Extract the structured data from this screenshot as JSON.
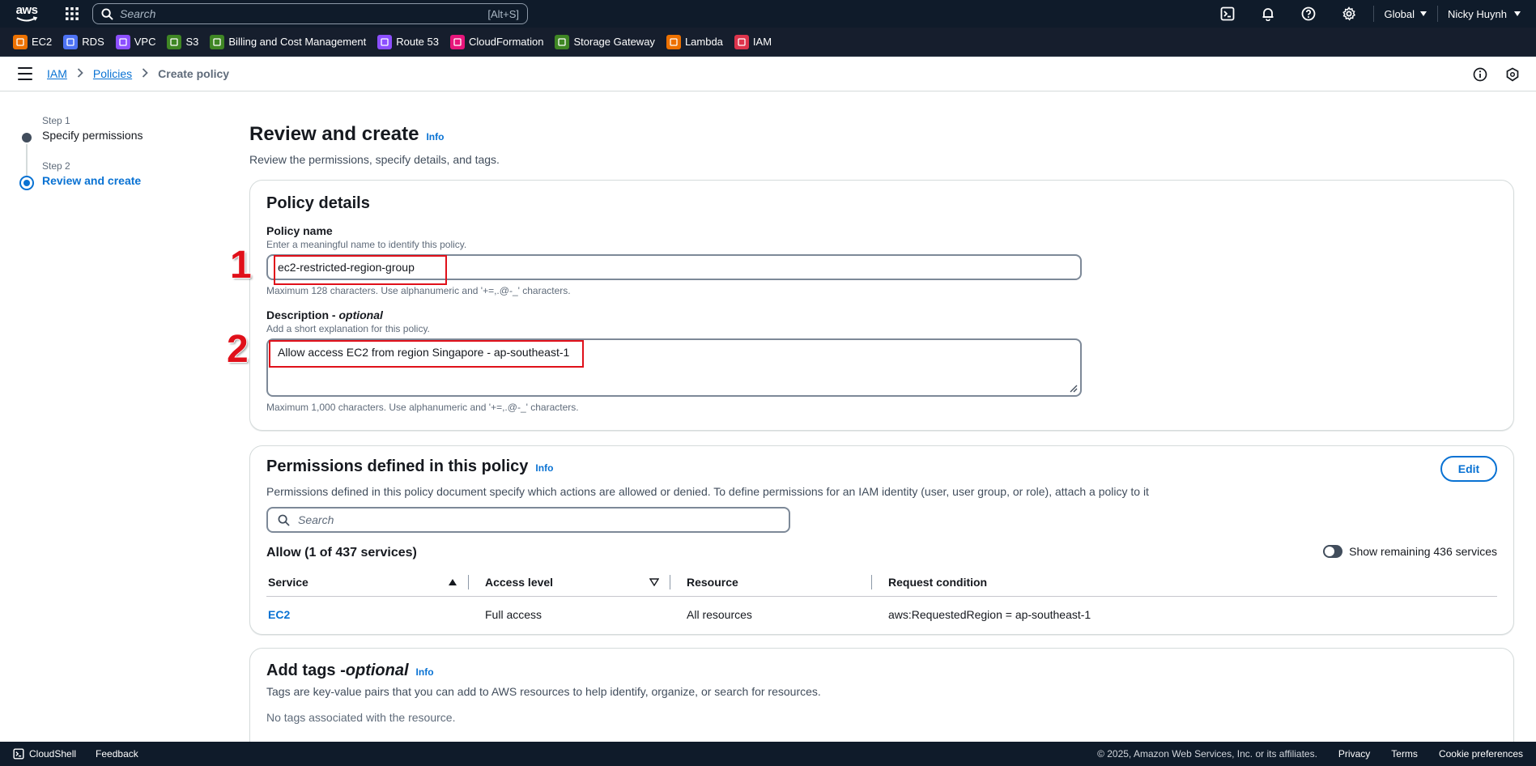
{
  "topnav": {
    "logo_text": "aws",
    "search_placeholder": "Search",
    "search_shortcut": "[Alt+S]",
    "region": "Global",
    "user": "Nicky Huynh"
  },
  "favorites": [
    {
      "label": "EC2",
      "color": "#ed7100"
    },
    {
      "label": "RDS",
      "color": "#4d72f3"
    },
    {
      "label": "VPC",
      "color": "#8c4fff"
    },
    {
      "label": "S3",
      "color": "#3f8624"
    },
    {
      "label": "Billing and Cost Management",
      "color": "#3f8624"
    },
    {
      "label": "Route 53",
      "color": "#8c4fff"
    },
    {
      "label": "CloudFormation",
      "color": "#e7157b"
    },
    {
      "label": "Storage Gateway",
      "color": "#3f8624"
    },
    {
      "label": "Lambda",
      "color": "#ed7100"
    },
    {
      "label": "IAM",
      "color": "#dd344c"
    }
  ],
  "breadcrumb": {
    "items": [
      "IAM",
      "Policies"
    ],
    "current": "Create policy"
  },
  "steps": [
    {
      "label": "Step 1",
      "title": "Specify permissions"
    },
    {
      "label": "Step 2",
      "title": "Review and create"
    }
  ],
  "page": {
    "title": "Review and create",
    "info": "Info",
    "subtitle": "Review the permissions, specify details, and tags."
  },
  "policy_details": {
    "heading": "Policy details",
    "name_label": "Policy name",
    "name_desc": "Enter a meaningful name to identify this policy.",
    "name_value": "ec2-restricted-region-group",
    "name_constraint": "Maximum 128 characters. Use alphanumeric and '+=,.@-_' characters.",
    "desc_label": "Description - ",
    "desc_optional": "optional",
    "desc_desc": "Add a short explanation for this policy.",
    "desc_value": "Allow access EC2 from region Singapore - ap-southeast-1",
    "desc_constraint": "Maximum 1,000 characters. Use alphanumeric and '+=,.@-_' characters."
  },
  "annotations": {
    "one": "1",
    "two": "2"
  },
  "permissions": {
    "heading": "Permissions defined in this policy",
    "info": "Info",
    "edit": "Edit",
    "description": "Permissions defined in this policy document specify which actions are allowed or denied. To define permissions for an IAM identity (user, user group, or role), attach a policy to it",
    "search_placeholder": "Search",
    "allow_heading": "Allow (1 of 437 services)",
    "toggle_label": "Show remaining 436 services",
    "columns": [
      "Service",
      "Access level",
      "Resource",
      "Request condition"
    ],
    "rows": [
      {
        "service": "EC2",
        "access": "Full access",
        "resource": "All resources",
        "condition": "aws:RequestedRegion = ap-southeast-1"
      }
    ]
  },
  "tags": {
    "heading": "Add tags - ",
    "optional": "optional",
    "info": "Info",
    "description": "Tags are key-value pairs that you can add to AWS resources to help identify, organize, or search for resources.",
    "empty": "No tags associated with the resource."
  },
  "footer": {
    "cloudshell": "CloudShell",
    "feedback": "Feedback",
    "copyright": "© 2025, Amazon Web Services, Inc. or its affiliates.",
    "privacy": "Privacy",
    "terms": "Terms",
    "cookies": "Cookie preferences"
  }
}
